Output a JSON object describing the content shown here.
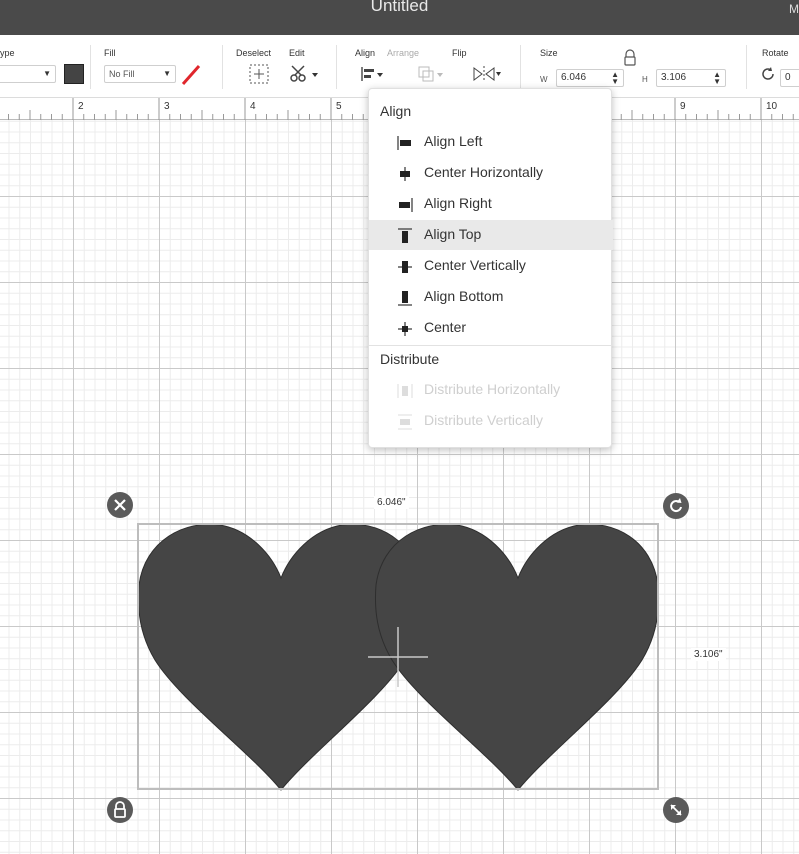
{
  "titlebar": {
    "title": "Untitled",
    "right_char": "M"
  },
  "toolbar": {
    "linetype_label": "ype",
    "fill_label": "Fill",
    "fill_value": "No Fill",
    "deselect_label": "Deselect",
    "edit_label": "Edit",
    "align_label": "Align",
    "arrange_label": "Arrange",
    "flip_label": "Flip",
    "size_label": "Size",
    "w_label": "W",
    "w_value": "6.046",
    "h_label": "H",
    "h_value": "3.106",
    "rotate_label": "Rotate",
    "rotate_value": "0"
  },
  "ruler": {
    "numbers": [
      "2",
      "3",
      "4",
      "5",
      "9",
      "10"
    ]
  },
  "align_menu": {
    "heading": "Align",
    "items": [
      {
        "label": "Align Left",
        "icon": "align-left-icon"
      },
      {
        "label": "Center Horizontally",
        "icon": "center-horizontally-icon"
      },
      {
        "label": "Align Right",
        "icon": "align-right-icon"
      },
      {
        "label": "Align Top",
        "icon": "align-top-icon",
        "highlighted": true
      },
      {
        "label": "Center Vertically",
        "icon": "center-vertically-icon"
      },
      {
        "label": "Align Bottom",
        "icon": "align-bottom-icon"
      },
      {
        "label": "Center",
        "icon": "center-icon"
      }
    ],
    "distribute_heading": "Distribute",
    "distribute_items": [
      {
        "label": "Distribute Horizontally",
        "icon": "distribute-horizontally-icon",
        "disabled": true
      },
      {
        "label": "Distribute Vertically",
        "icon": "distribute-vertically-icon",
        "disabled": true
      }
    ]
  },
  "selection": {
    "width_label": "6.046\"",
    "height_label": "3.106\""
  },
  "colors": {
    "shape_fill": "#454545",
    "titlebar": "#4a4a4a",
    "no_fill_slash": "#e0262c"
  }
}
